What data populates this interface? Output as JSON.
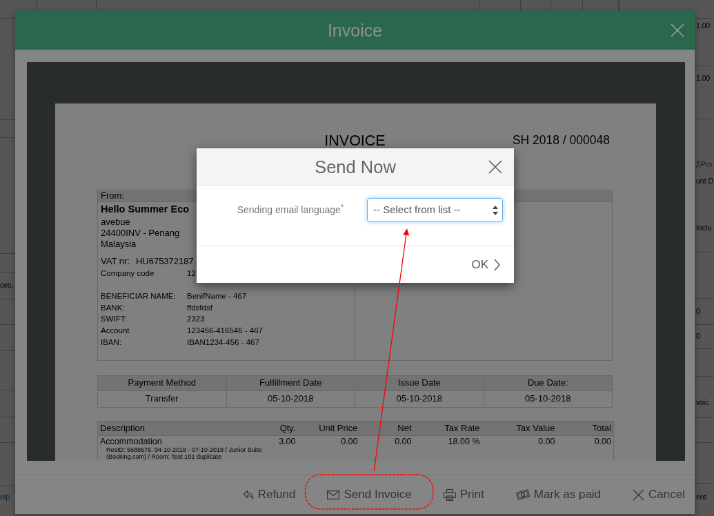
{
  "background": {
    "left_fragments": [
      {
        "text": "ces,",
        "kind": "text"
      },
      {
        "text": "elp",
        "kind": "link"
      }
    ],
    "right_fragments": [
      {
        "text": "1.00",
        "kind": "text"
      },
      {
        "text": "1.00",
        "kind": "text"
      },
      {
        "text": "Pro",
        "kind": "icon_link"
      },
      {
        "text": "unt D",
        "kind": "text"
      },
      {
        "text": "Inclu",
        "kind": "text"
      },
      {
        "text": "0",
        "kind": "text"
      },
      {
        "text": "0",
        "kind": "text"
      },
      {
        "text": "voic",
        "kind": "text"
      },
      {
        "text": "ent",
        "kind": "text"
      }
    ]
  },
  "invoice_modal": {
    "title": "Invoice",
    "document": {
      "heading": "INVOICE",
      "number": "SH 2018 / 000048",
      "from": {
        "header": "From:",
        "company": "Hello Summer Eco",
        "address_lines": [
          "avebue",
          "24400INV - Penang",
          "Malaysia"
        ],
        "vat_label": "VAT nr:",
        "vat_value": "HU675372187",
        "company_code_label": "Company code",
        "company_code_value": "12",
        "bank_details": [
          {
            "label": "BENEFICIAR NAME:",
            "value": "BenifName - 467"
          },
          {
            "label": "BANK:",
            "value": "ffdsfdsf"
          },
          {
            "label": "SWIFT:",
            "value": "2323"
          },
          {
            "label": "Account",
            "value": "123456-416546 - 467"
          },
          {
            "label": "IBAN:",
            "value": "IBAN1234-456 - 467"
          }
        ]
      },
      "payment_table": {
        "columns": [
          "Payment Method",
          "Fulfillment Date",
          "Issue Date",
          "Due Date:"
        ],
        "rows": [
          [
            "Transfer",
            "05-10-2018",
            "05-10-2018",
            "05-10-2018"
          ]
        ]
      },
      "items_table": {
        "columns": [
          "Description",
          "Qty.",
          "Unit Price",
          "Net",
          "Tax Rate",
          "Tax Value",
          "Total"
        ],
        "rows": [
          {
            "cells": [
              "Accommodation",
              "3.00",
              "0.00",
              "0.00",
              "18.00 %",
              "0.00",
              "0.00"
            ],
            "details": [
              "ResID: 5688576. 04-10-2018 - 07-10-2018 / Junior Suite",
              "(Booking.com) / Room: Test 101 duplicate"
            ]
          }
        ]
      }
    },
    "footer_buttons": [
      {
        "label": "Refund",
        "highlighted": false
      },
      {
        "label": "Send Invoice",
        "highlighted": true
      },
      {
        "label": "Print",
        "highlighted": false
      },
      {
        "label": "Mark as paid",
        "highlighted": false
      },
      {
        "label": "Cancel",
        "highlighted": false
      }
    ]
  },
  "send_dialog": {
    "title": "Send Now",
    "field_label": "Sending email language$^{*}$",
    "select": {
      "value": "-- Select from list --",
      "focused": true
    },
    "ok_label": "OK"
  }
}
